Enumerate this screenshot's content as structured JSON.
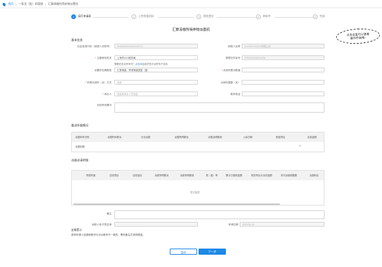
{
  "breadcrumb": {
    "home": "首页",
    "items": [
      "一条龙（批）前管理",
      "汇算清缴所得弃物派置机"
    ]
  },
  "steps": [
    {
      "num": "1",
      "label": "填写申请表"
    },
    {
      "num": "2",
      "label": "上传附报资料"
    },
    {
      "num": "3",
      "label": "预览提交"
    },
    {
      "num": "4",
      "label": "审核中"
    },
    {
      "num": "5",
      "label": "完成"
    }
  ],
  "bubble": {
    "line1": "点击这里可以查看",
    "line2": "操作手册哦~"
  },
  "page_title": "汇算清缴所得弃物派置机",
  "basic": {
    "section": "基本信息",
    "credit_code_label": "社会信用代码（纳税人识别号）",
    "credit_code_value": "91310000XXXXXXXXXX",
    "taxpayer_name_label": "纳税人名称",
    "taxpayer_name_value": "XXXXXXXXXXX有限公司",
    "tax_authority_label": "主管税务机关",
    "tax_authority_value": "上海市XXX税务局",
    "serial_label": "受理文件序号",
    "serial_value": "2FS2434234234234",
    "hint_prefix": "需要在查派所有号？",
    "hint_link": "点击",
    "hint_suffix": "添加维护查次派所有户机机",
    "agency_type_label": "派置所业确类型",
    "agency_type_value": "汇算清缴，所得清缴类型（报）",
    "agency_code_label": "派到所属派数值",
    "agency_reg_label": "申请派到所（派）方式",
    "agency_reg_value": "选择",
    "agency_fee_label": "派到所属额（派）",
    "tax_person_label": "承办人",
    "tax_person_value": "请选择承办人员信息",
    "contact_label": "联系电话",
    "desc_label": "派到所用情况"
  },
  "filing": {
    "section": "重派所据情况",
    "columns": [
      "派据年所识别",
      "派据时间是派",
      "分派派据",
      "派据所得额派",
      "派据派得额收",
      "入库日期",
      "税费项目",
      "实费金额"
    ],
    "row": {
      "cell1": "派据总额",
      "plus": "+"
    }
  },
  "detail": {
    "section": "派据派清明细",
    "columns": [
      "所属年度",
      "征收项目",
      "征收品目",
      "派款所得额派",
      "派款所得额收",
      "税（费）率",
      "累计已缴税金额",
      "税务所出示派扣金额",
      "本次派缴税额额",
      "派缴科目"
    ],
    "empty": "暂无数据"
  },
  "remark_label": "备注",
  "signer_label": "纳税人电子签名单",
  "apply_date_label": "申请日期",
  "apply_date_value": "2020-04-10",
  "notice": {
    "title": "友情提示：",
    "body": "退申申请人选退税账号与派派账号不一致的，需在备注栏说明原因。"
  },
  "buttons": {
    "save": "暂存",
    "next": "下一步"
  },
  "colors": {
    "accent": "#1e88e5",
    "required": "#e53935"
  }
}
